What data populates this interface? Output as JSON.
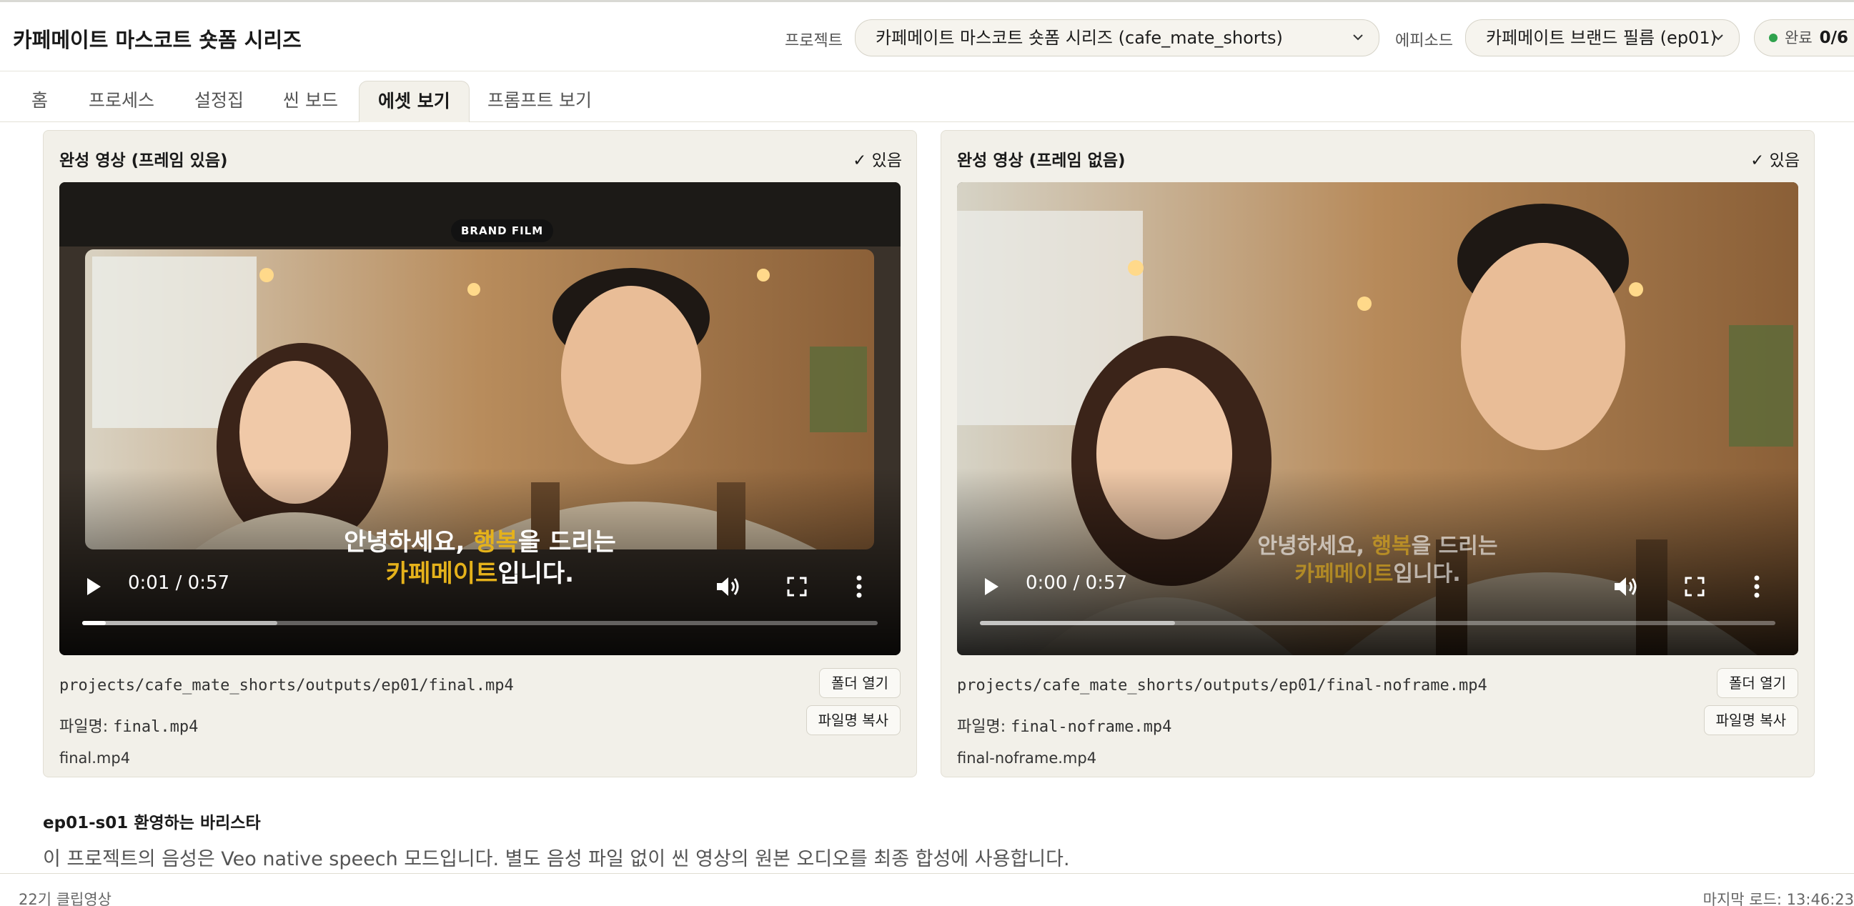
{
  "app": {
    "title": "카페메이트 마스코트 숏폼 시리즈"
  },
  "header": {
    "project_label": "프로젝트",
    "project_value": "카페메이트 마스코트 숏폼 시리즈 (cafe_mate_shorts)",
    "episode_label": "에피소드",
    "episode_value": "카페메이트 브랜드 필름 (ep01)",
    "status_label": "완료",
    "status_count": "0/6"
  },
  "tabs": [
    {
      "label": "홈"
    },
    {
      "label": "프로세스"
    },
    {
      "label": "설정집"
    },
    {
      "label": "씬 보드"
    },
    {
      "label": "에셋 보기",
      "active": true
    },
    {
      "label": "프롬프트 보기"
    }
  ],
  "panels": [
    {
      "title": "완성 영상 (프레임 있음)",
      "check": "✓ 있음",
      "badge": "BRAND FILM",
      "subtitle_line1_a": "안녕하세요, ",
      "subtitle_line1_b": "행복",
      "subtitle_line1_c": "을 드리는",
      "subtitle_line2_a": "카페메이트",
      "subtitle_line2_b": "입니다.",
      "time": "0:01 / 0:57",
      "progress_played": 0.03,
      "progress_buffered": 0.245,
      "path": "projects/cafe_mate_shorts/outputs/ep01/final.mp4",
      "filename_label": "파일명: ",
      "filename": "final.mp4",
      "filename_plain": "final.mp4",
      "btn_open": "폴더 열기",
      "btn_copy": "파일명 복사"
    },
    {
      "title": "완성 영상 (프레임 없음)",
      "check": "✓ 있음",
      "subtitle_line1_a": "안녕하세요, ",
      "subtitle_line1_b": "행복",
      "subtitle_line1_c": "을 드리는",
      "subtitle_line2_a": "카페메이트",
      "subtitle_line2_b": "입니다.",
      "time": "0:00 / 0:57",
      "progress_played": 0.0,
      "progress_buffered": 0.245,
      "path": "projects/cafe_mate_shorts/outputs/ep01/final-noframe.mp4",
      "filename_label": "파일명: ",
      "filename": "final-noframe.mp4",
      "filename_plain": "final-noframe.mp4",
      "btn_open": "폴더 열기",
      "btn_copy": "파일명 복사"
    }
  ],
  "scene": {
    "title": "ep01-s01 환영하는 바리스타",
    "description": "이 프로젝트의 음성은 Veo native speech 모드입니다. 별도 음성 파일 없이 씬 영상의 원본 오디오를 최종 합성에 사용합니다."
  },
  "statusbar": {
    "left": "22기 클립영상",
    "right": "마지막 로드: 13:46:23"
  },
  "colors": {
    "accent_yellow": "#e5b21b",
    "status_green": "#2fa24d",
    "panel_bg": "#f2f0e9"
  }
}
